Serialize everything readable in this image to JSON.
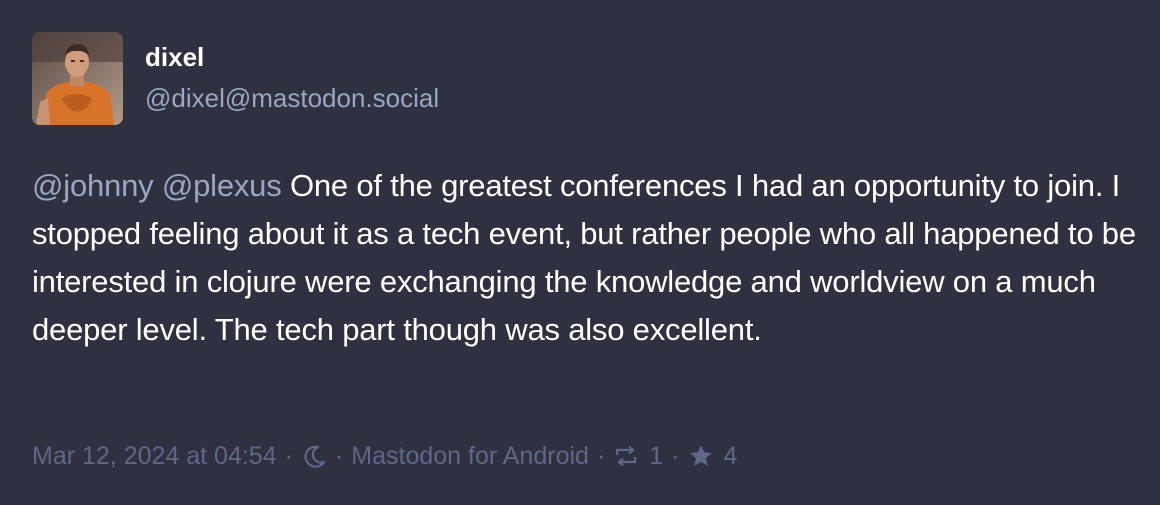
{
  "author": {
    "display_name": "dixel",
    "handle": "@dixel@mastodon.social",
    "avatar_icon": "user-avatar-photo"
  },
  "post": {
    "mentions": [
      "@johnny",
      "@plexus"
    ],
    "text": "One of the greatest conferences I had an opportunity to join. I stopped feeling about it as a tech event, but rather people who all happened to be interested in clojure were exchanging the knowledge and worldview on a much deeper level. The tech part though was also excellent."
  },
  "meta": {
    "timestamp": "Mar 12, 2024 at 04:54",
    "separator": "·",
    "visibility_icon": "moon-icon",
    "client": "Mastodon for Android",
    "boost_icon": "boost-icon",
    "boost_count": "1",
    "favourite_icon": "star-icon",
    "favourite_count": "4"
  },
  "colors": {
    "background": "#2f3140",
    "text": "#ffffff",
    "accent": "#9aa6c4",
    "muted": "#5f6788"
  }
}
